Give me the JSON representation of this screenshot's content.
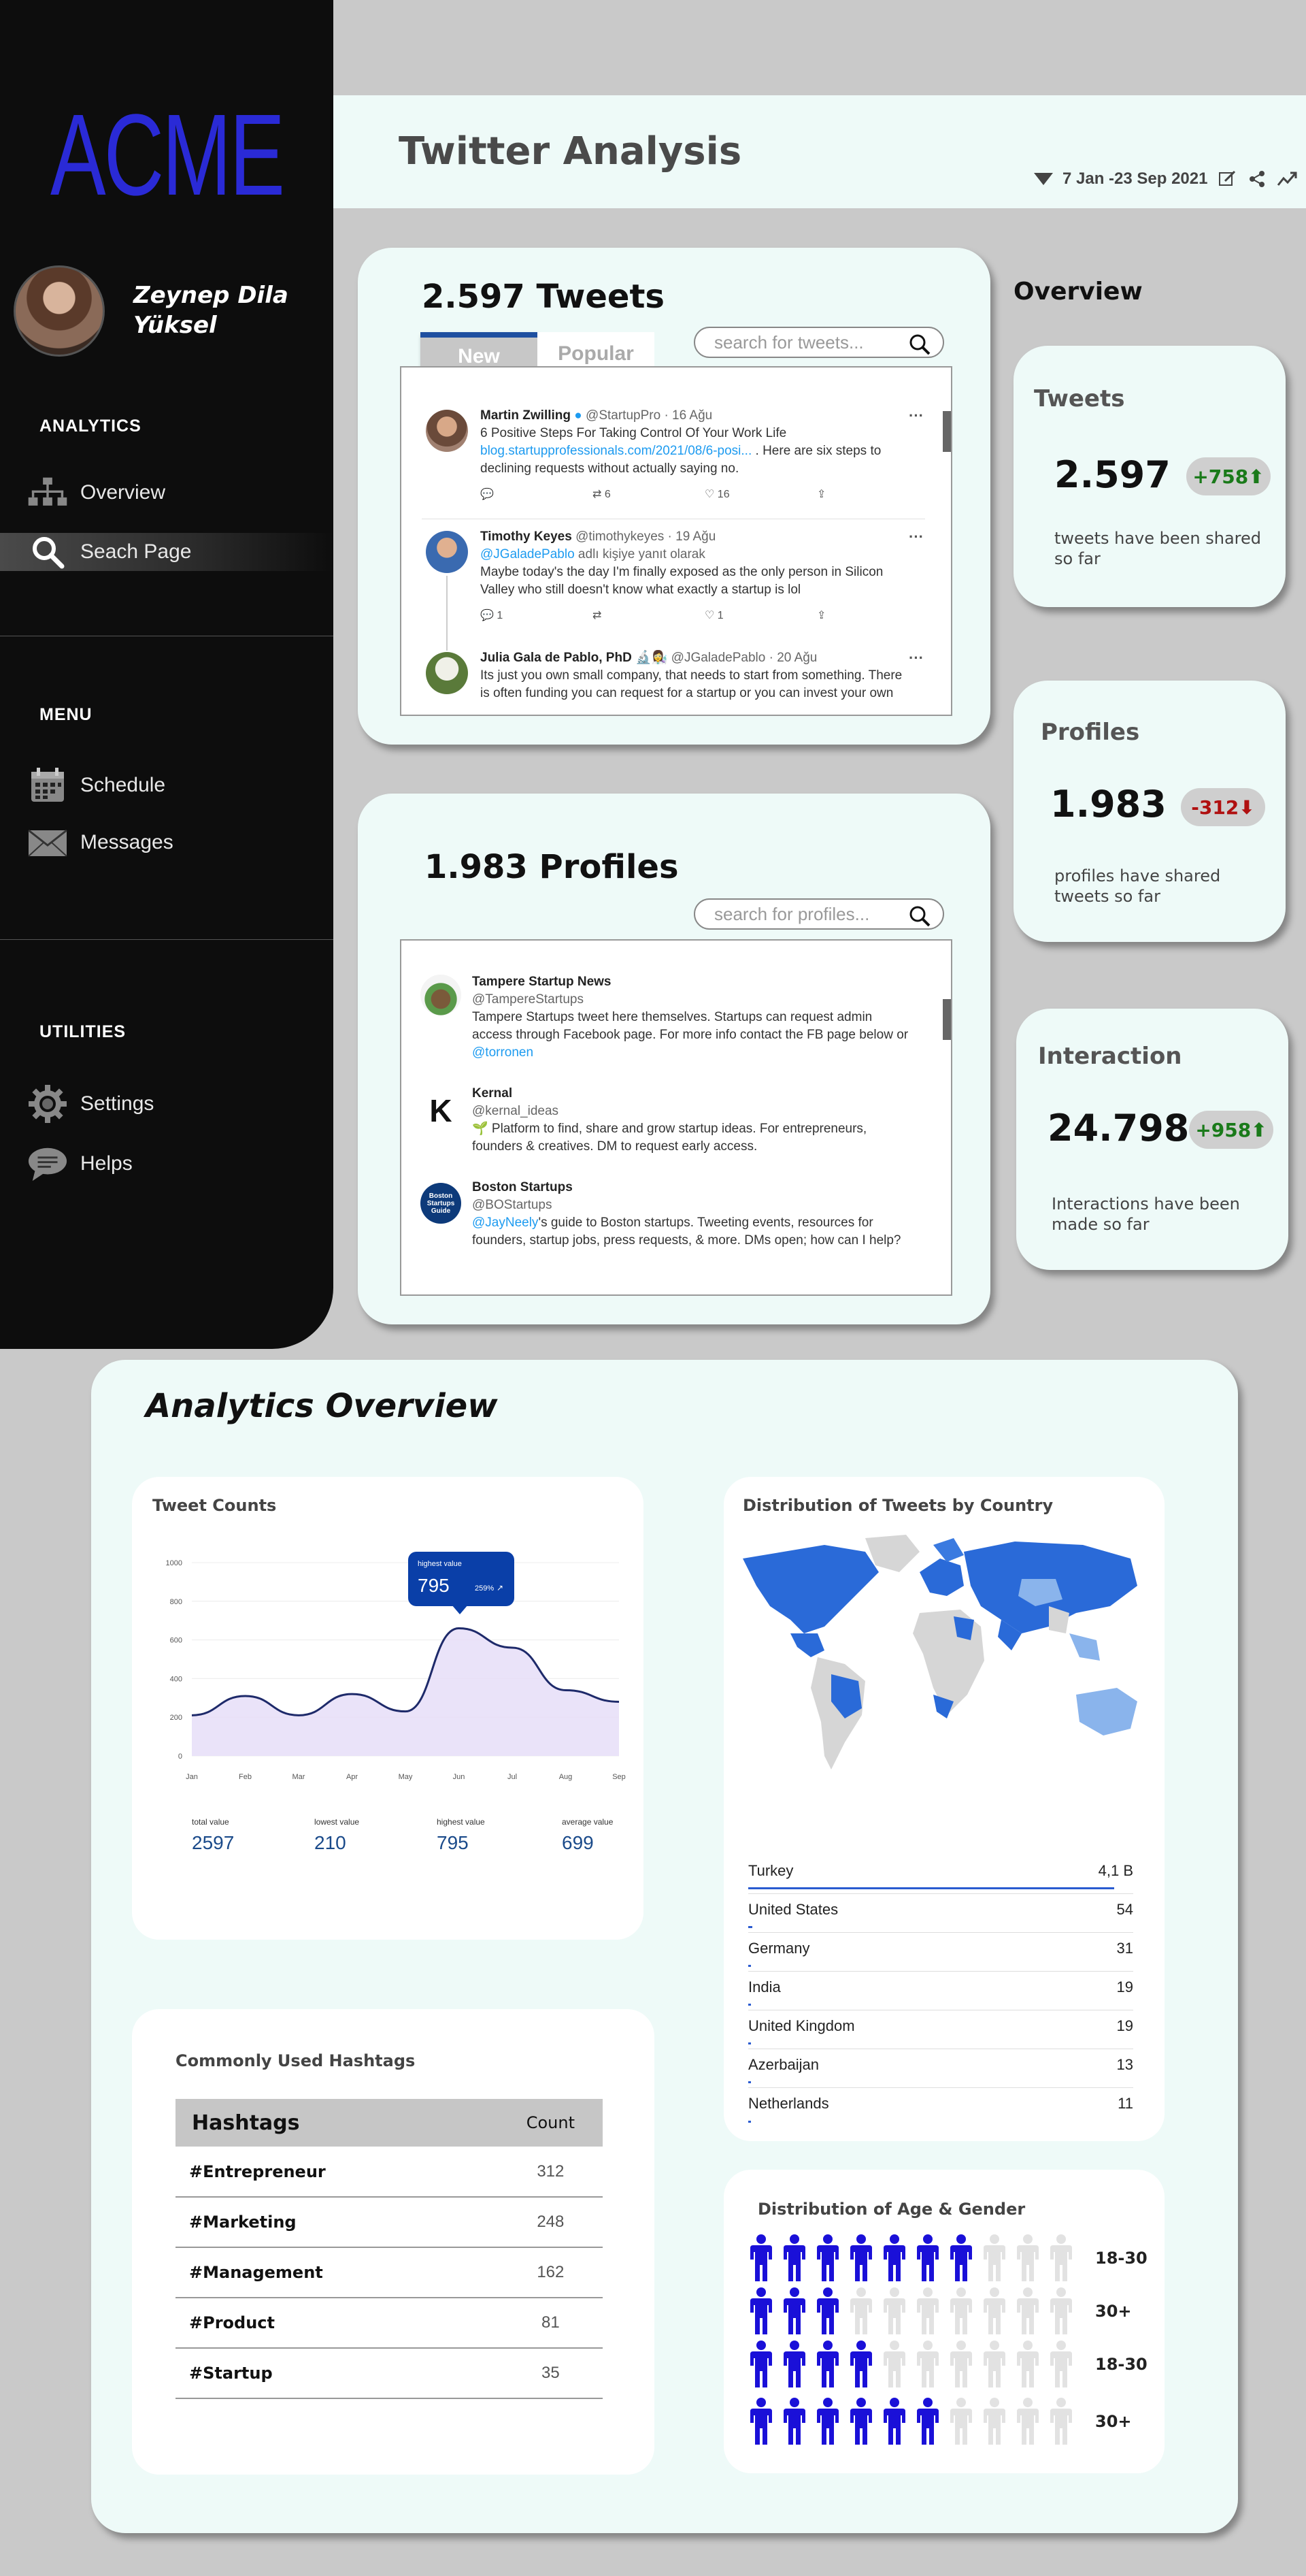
{
  "sidebar": {
    "logo": "ACME",
    "user_name": "Zeynep Dila Yüksel",
    "analytics_header": "ANALYTICS",
    "menu_header": "MENU",
    "utilities_header": "UTILITIES",
    "items": [
      {
        "label": "Overview",
        "icon": "sitemap-icon"
      },
      {
        "label": "Seach Page",
        "icon": "search-icon"
      },
      {
        "label": "Schedule",
        "icon": "calendar-icon"
      },
      {
        "label": "Messages",
        "icon": "envelope-icon"
      },
      {
        "label": "Settings",
        "icon": "gear-icon"
      },
      {
        "label": "Helps",
        "icon": "chat-bubble-icon"
      }
    ]
  },
  "header": {
    "title": "Twitter Analysis",
    "date_range": "7 Jan -23 Sep 2021"
  },
  "tweets_card": {
    "title": "2.597 Tweets",
    "search_placeholder": "search for tweets...",
    "tabs": [
      "New",
      "Popular"
    ],
    "tweets": [
      {
        "name": "Martin Zwilling",
        "handle": "@StartupPro · 16 Ağu",
        "text1": "6 Positive Steps For Taking Control Of Your Work Life",
        "link": "blog.startupprofessionals.com/2021/08/6-posi... ",
        "text2": ". Here are six steps to",
        "text3": "declining requests without actually saying no.",
        "replies": "",
        "retweets": "6",
        "likes": "16"
      },
      {
        "name": "Timothy Keyes",
        "handle": "@timothykeyes · 19 Ağu",
        "reply_to": "@JGaladePablo",
        "reply_suffix": " adlı kişiye yanıt olarak",
        "text1": "Maybe today's the day I'm finally exposed as the only person in Silicon",
        "text2": "Valley who still doesn't know what exactly a startup is lol",
        "replies": "1",
        "retweets": "",
        "likes": "1"
      },
      {
        "name": "Julia Gala de Pablo, PhD 🔬👩‍🔬",
        "handle": "@JGaladePablo · 20 Ağu",
        "text1": "Its just you own small company, that needs to start from something. There",
        "text2": "is often funding you can request for a startup or you can invest your own"
      }
    ]
  },
  "profiles_card": {
    "title": "1.983 Profiles",
    "search_placeholder": "search for profiles...",
    "profiles": [
      {
        "name": "Tampere Startup News",
        "handle": "@TampereStartups",
        "bio1": "Tampere Startups tweet here themselves. Startups can request admin",
        "bio2": "access through Facebook page. For more info contact the FB page below or",
        "bio3": "@torronen"
      },
      {
        "name": "Kernal",
        "handle": "@kernal_ideas",
        "bio1": "🌱 Platform to find, share and grow startup ideas. For entrepreneurs,",
        "bio2": "founders & creatives. DM to request early access."
      },
      {
        "name": "Boston Startups",
        "handle": "@BOStartups",
        "bio_link": "@JayNeely",
        "bio1": "'s guide to Boston startups. Tweeting events, resources for",
        "bio2": "founders, startup jobs, press requests, & more. DMs open; how can I help?",
        "logo_text": "Boston Startups Guide"
      }
    ]
  },
  "overview": {
    "title": "Overview",
    "stats": [
      {
        "label": "Tweets",
        "value": "2.597",
        "delta": "+758",
        "direction": "up",
        "color": "#1a7a1a",
        "desc": "tweets have been shared so far"
      },
      {
        "label": "Profiles",
        "value": "1.983",
        "delta": "-312",
        "direction": "down",
        "color": "#b01010",
        "desc": "profiles have shared tweets so far"
      },
      {
        "label": "Interaction",
        "value": "24.798",
        "delta": "+958",
        "direction": "up",
        "color": "#1a7a1a",
        "desc": "Interactions have been made so far"
      }
    ]
  },
  "analytics": {
    "title": "Analytics Overview",
    "tweet_counts": {
      "title": "Tweet Counts",
      "tooltip_label": "highest value",
      "tooltip_value": "795",
      "tooltip_pct": "259%",
      "kpis": [
        {
          "label": "total value",
          "value": "2597"
        },
        {
          "label": "lowest value",
          "value": "210"
        },
        {
          "label": "highest value",
          "value": "795"
        },
        {
          "label": "average value",
          "value": "699"
        }
      ]
    },
    "country": {
      "title": "Distribution of Tweets by Country",
      "rows": [
        {
          "name": "Turkey",
          "value": "4,1 B",
          "share": 1.0
        },
        {
          "name": "United States",
          "value": "54",
          "share": 0.012
        },
        {
          "name": "Germany",
          "value": "31",
          "share": 0.008
        },
        {
          "name": "India",
          "value": "19",
          "share": 0.005
        },
        {
          "name": "United Kingdom",
          "value": "19",
          "share": 0.005
        },
        {
          "name": "Azerbaijan",
          "value": "13",
          "share": 0.004
        },
        {
          "name": "Netherlands",
          "value": "11",
          "share": 0.003
        }
      ]
    },
    "hashtags": {
      "title": "Commonly Used Hashtags",
      "col_hashtag": "Hashtags",
      "col_count": "Count",
      "rows": [
        {
          "tag": "#Entrepreneur",
          "count": "312"
        },
        {
          "tag": "#Marketing",
          "count": "248"
        },
        {
          "tag": "#Management",
          "count": "162"
        },
        {
          "tag": "#Product",
          "count": "81"
        },
        {
          "tag": "#Startup",
          "count": "35"
        }
      ]
    },
    "age_gender": {
      "title": "Distribution of Age & Gender",
      "rows": [
        {
          "label": "18-30",
          "filled": 7,
          "total": 10
        },
        {
          "label": "30+",
          "filled": 3,
          "total": 10
        },
        {
          "label": "18-30",
          "filled": 4,
          "total": 10
        },
        {
          "label": "30+",
          "filled": 6,
          "total": 10
        }
      ],
      "fill_color": "#1a10d8",
      "empty_color": "#e2e2e2"
    }
  },
  "chart_data": {
    "type": "area",
    "categories": [
      "Jan",
      "Feb",
      "Mar",
      "Apr",
      "May",
      "Jun",
      "Jul",
      "Aug",
      "Sep"
    ],
    "values": [
      210,
      310,
      210,
      320,
      230,
      660,
      560,
      340,
      280
    ],
    "ylim": [
      0,
      1000
    ],
    "yticks": [
      0,
      200,
      400,
      600,
      800,
      1000
    ],
    "grid": true,
    "line_color": "#1e2a6a",
    "fill_color": "#e6def8"
  }
}
